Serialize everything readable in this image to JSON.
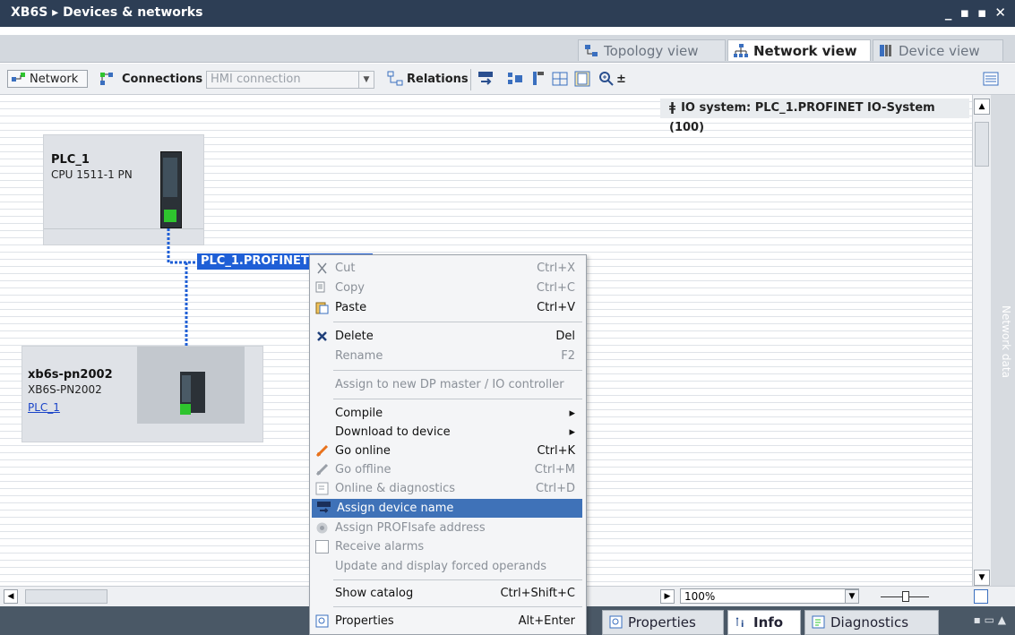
{
  "window": {
    "title": "XB6S ▸ Devices & networks",
    "controls": "_ ▪ ▪ ✕"
  },
  "view_tabs": [
    {
      "label": "Topology view",
      "icon": "topology-icon"
    },
    {
      "label": "Network view",
      "icon": "network-icon",
      "active": true
    },
    {
      "label": "Device view",
      "icon": "device-icon"
    }
  ],
  "toolbar": {
    "network_label": "Network",
    "connections_label": "Connections",
    "connection_type_value": "HMI connection",
    "relations_label": "Relations",
    "zoom_symbol": "±"
  },
  "canvas": {
    "io_system_label": "IO system: PLC_1.PROFINET IO-System (100)",
    "network_line_label": "PLC_1.PROFINET IO-System",
    "plc": {
      "name": "PLC_1",
      "type": "CPU 1511-1 PN"
    },
    "device": {
      "name": "xb6s-pn2002",
      "type": "XB6S-PN2002",
      "controller_link": "PLC_1"
    }
  },
  "side_panel": {
    "label": "Network data"
  },
  "context_menu": {
    "items": [
      {
        "label": "Cut",
        "shortcut": "Ctrl+X",
        "disabled": true,
        "icon": "cut-icon"
      },
      {
        "label": "Copy",
        "shortcut": "Ctrl+C",
        "disabled": true,
        "icon": "copy-icon"
      },
      {
        "label": "Paste",
        "shortcut": "Ctrl+V",
        "disabled": false,
        "icon": "paste-icon"
      },
      {
        "label": "Delete",
        "shortcut": "Del",
        "disabled": false,
        "icon": "delete-icon"
      },
      {
        "label": "Rename",
        "shortcut": "F2",
        "disabled": true
      },
      {
        "label": "Assign to new DP master / IO controller",
        "shortcut": "",
        "disabled": true
      },
      {
        "label": "Compile",
        "shortcut": "",
        "disabled": false,
        "submenu": true
      },
      {
        "label": "Download to device",
        "shortcut": "",
        "disabled": false,
        "submenu": true
      },
      {
        "label": "Go online",
        "shortcut": "Ctrl+K",
        "disabled": false,
        "icon": "go-online-icon"
      },
      {
        "label": "Go offline",
        "shortcut": "Ctrl+M",
        "disabled": true,
        "icon": "go-offline-icon"
      },
      {
        "label": "Online & diagnostics",
        "shortcut": "Ctrl+D",
        "disabled": true,
        "icon": "diagnostics-icon"
      },
      {
        "label": "Assign device name",
        "shortcut": "",
        "disabled": false,
        "highlighted": true,
        "icon": "assign-name-icon"
      },
      {
        "label": "Assign PROFIsafe address",
        "shortcut": "",
        "disabled": true,
        "icon": "profisafe-icon"
      },
      {
        "label": "Receive alarms",
        "shortcut": "",
        "disabled": true,
        "icon": "checkbox-icon"
      },
      {
        "label": "Update and display forced operands",
        "shortcut": "",
        "disabled": true
      },
      {
        "label": "Show catalog",
        "shortcut": "Ctrl+Shift+C",
        "disabled": false
      },
      {
        "label": "Properties",
        "shortcut": "Alt+Enter",
        "disabled": false,
        "icon": "properties-icon"
      }
    ]
  },
  "bottom": {
    "zoom_value": "100%",
    "tabs": [
      {
        "label": "Properties",
        "icon": "properties-icon"
      },
      {
        "label": "Info",
        "icon": "info-icon"
      },
      {
        "label": "Diagnostics",
        "icon": "diagnostics-icon"
      }
    ]
  },
  "colors": {
    "title_bar": "#2d3e55",
    "highlight": "#3f72b8",
    "network_line": "#1f5fd6",
    "status_green": "#2ec42e"
  }
}
